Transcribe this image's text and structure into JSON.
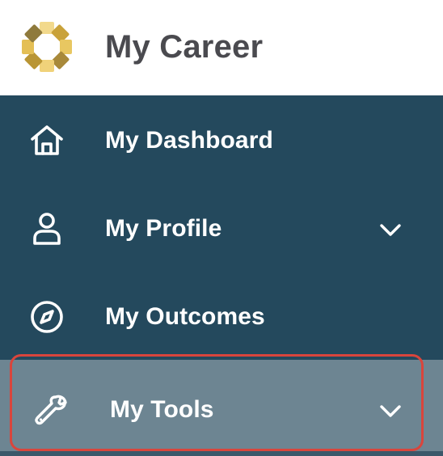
{
  "header": {
    "app_title": "My Career",
    "logo_icon": "career-logo-icon"
  },
  "nav": {
    "items": [
      {
        "label": "My Dashboard",
        "icon": "home-icon",
        "has_chevron": false,
        "selected": false
      },
      {
        "label": "My Profile",
        "icon": "user-icon",
        "has_chevron": true,
        "selected": false
      },
      {
        "label": "My Outcomes",
        "icon": "compass-icon",
        "has_chevron": false,
        "selected": false
      },
      {
        "label": "My Tools",
        "icon": "wrench-icon",
        "has_chevron": true,
        "selected": true
      }
    ]
  },
  "colors": {
    "nav_background": "#24495d",
    "selected_background": "#6d8592",
    "highlight_outline": "#d9453c",
    "logo_gold": "#e0b84a"
  }
}
